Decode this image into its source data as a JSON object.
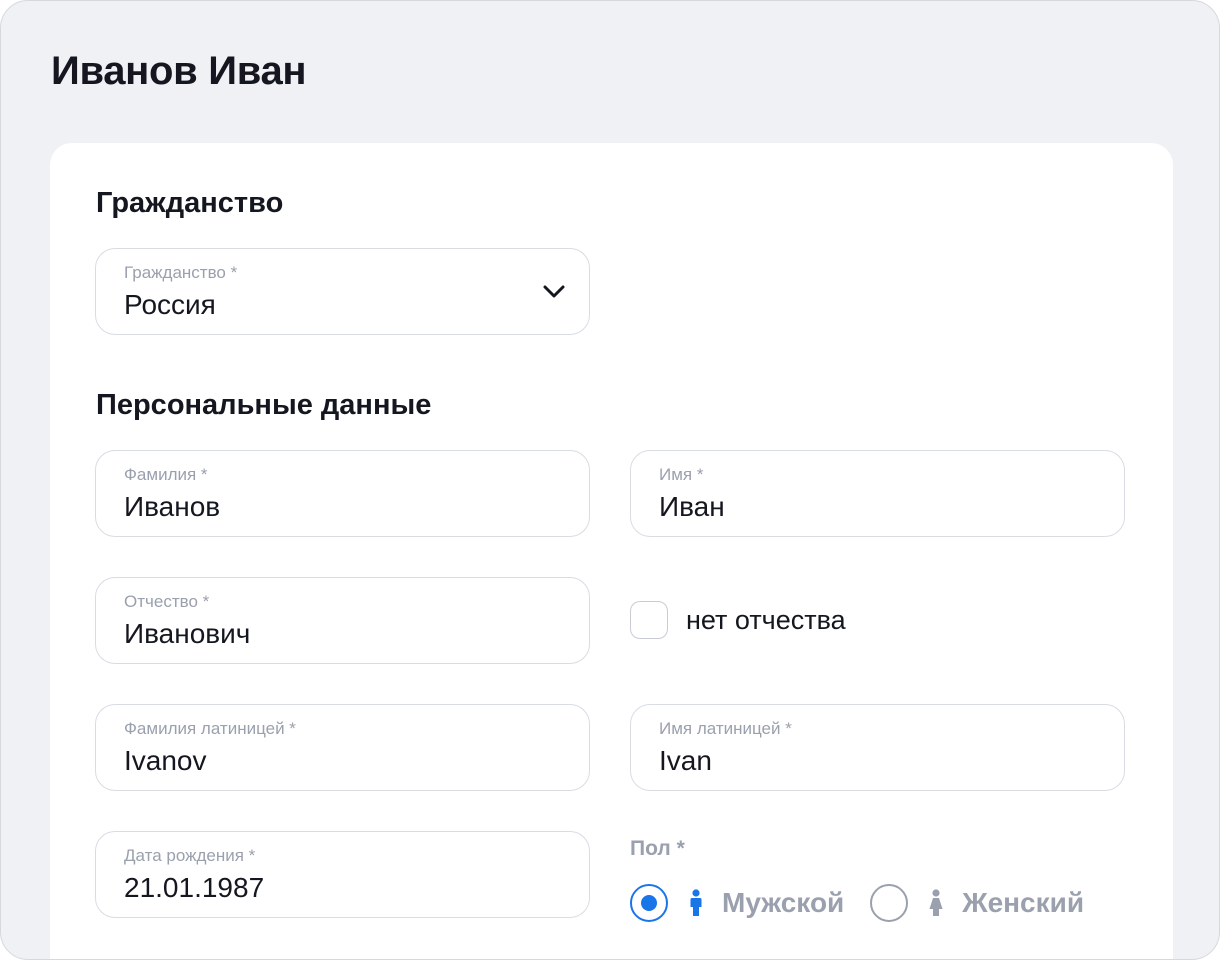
{
  "page": {
    "title": "Иванов Иван"
  },
  "citizenship": {
    "section_title": "Гражданство",
    "field_label": "Гражданство *",
    "field_value": "Россия"
  },
  "personal": {
    "section_title": "Персональные данные",
    "last_name": {
      "label": "Фамилия *",
      "value": "Иванов"
    },
    "first_name": {
      "label": "Имя *",
      "value": "Иван"
    },
    "patronymic": {
      "label": "Отчество *",
      "value": "Иванович"
    },
    "no_patronymic": {
      "label": "нет отчества",
      "checked": false
    },
    "last_name_latin": {
      "label": "Фамилия латиницей *",
      "value": "Ivanov"
    },
    "first_name_latin": {
      "label": "Имя латиницей *",
      "value": "Ivan"
    },
    "birth_date": {
      "label": "Дата рождения *",
      "value": "21.01.1987"
    },
    "gender": {
      "label": "Пол *",
      "options": [
        {
          "label": "Мужской",
          "selected": true,
          "icon": "male-icon"
        },
        {
          "label": "Женский",
          "selected": false,
          "icon": "female-icon"
        }
      ]
    }
  },
  "colors": {
    "accent": "#1976e8",
    "muted": "#9aa0ad",
    "text": "#14171f",
    "background": "#f0f1f5"
  }
}
